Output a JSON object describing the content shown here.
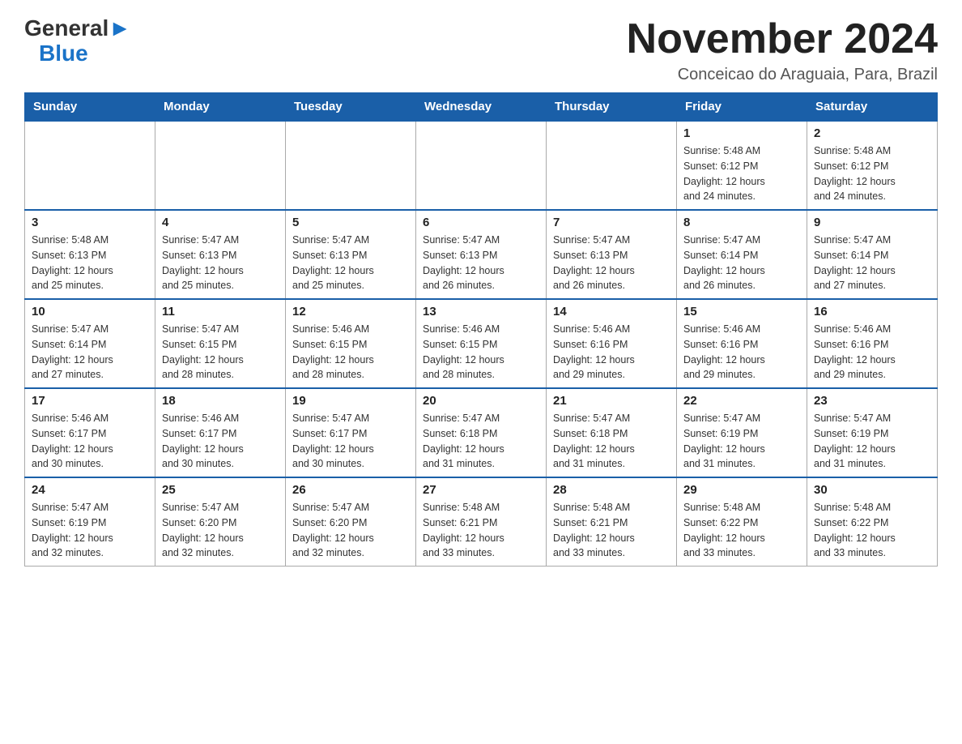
{
  "header": {
    "logo": {
      "general": "General",
      "blue": "Blue",
      "arrow": "▶"
    },
    "title": "November 2024",
    "location": "Conceicao do Araguaia, Para, Brazil"
  },
  "days_of_week": [
    "Sunday",
    "Monday",
    "Tuesday",
    "Wednesday",
    "Thursday",
    "Friday",
    "Saturday"
  ],
  "weeks": [
    [
      {
        "day": "",
        "info": ""
      },
      {
        "day": "",
        "info": ""
      },
      {
        "day": "",
        "info": ""
      },
      {
        "day": "",
        "info": ""
      },
      {
        "day": "",
        "info": ""
      },
      {
        "day": "1",
        "info": "Sunrise: 5:48 AM\nSunset: 6:12 PM\nDaylight: 12 hours\nand 24 minutes."
      },
      {
        "day": "2",
        "info": "Sunrise: 5:48 AM\nSunset: 6:12 PM\nDaylight: 12 hours\nand 24 minutes."
      }
    ],
    [
      {
        "day": "3",
        "info": "Sunrise: 5:48 AM\nSunset: 6:13 PM\nDaylight: 12 hours\nand 25 minutes."
      },
      {
        "day": "4",
        "info": "Sunrise: 5:47 AM\nSunset: 6:13 PM\nDaylight: 12 hours\nand 25 minutes."
      },
      {
        "day": "5",
        "info": "Sunrise: 5:47 AM\nSunset: 6:13 PM\nDaylight: 12 hours\nand 25 minutes."
      },
      {
        "day": "6",
        "info": "Sunrise: 5:47 AM\nSunset: 6:13 PM\nDaylight: 12 hours\nand 26 minutes."
      },
      {
        "day": "7",
        "info": "Sunrise: 5:47 AM\nSunset: 6:13 PM\nDaylight: 12 hours\nand 26 minutes."
      },
      {
        "day": "8",
        "info": "Sunrise: 5:47 AM\nSunset: 6:14 PM\nDaylight: 12 hours\nand 26 minutes."
      },
      {
        "day": "9",
        "info": "Sunrise: 5:47 AM\nSunset: 6:14 PM\nDaylight: 12 hours\nand 27 minutes."
      }
    ],
    [
      {
        "day": "10",
        "info": "Sunrise: 5:47 AM\nSunset: 6:14 PM\nDaylight: 12 hours\nand 27 minutes."
      },
      {
        "day": "11",
        "info": "Sunrise: 5:47 AM\nSunset: 6:15 PM\nDaylight: 12 hours\nand 28 minutes."
      },
      {
        "day": "12",
        "info": "Sunrise: 5:46 AM\nSunset: 6:15 PM\nDaylight: 12 hours\nand 28 minutes."
      },
      {
        "day": "13",
        "info": "Sunrise: 5:46 AM\nSunset: 6:15 PM\nDaylight: 12 hours\nand 28 minutes."
      },
      {
        "day": "14",
        "info": "Sunrise: 5:46 AM\nSunset: 6:16 PM\nDaylight: 12 hours\nand 29 minutes."
      },
      {
        "day": "15",
        "info": "Sunrise: 5:46 AM\nSunset: 6:16 PM\nDaylight: 12 hours\nand 29 minutes."
      },
      {
        "day": "16",
        "info": "Sunrise: 5:46 AM\nSunset: 6:16 PM\nDaylight: 12 hours\nand 29 minutes."
      }
    ],
    [
      {
        "day": "17",
        "info": "Sunrise: 5:46 AM\nSunset: 6:17 PM\nDaylight: 12 hours\nand 30 minutes."
      },
      {
        "day": "18",
        "info": "Sunrise: 5:46 AM\nSunset: 6:17 PM\nDaylight: 12 hours\nand 30 minutes."
      },
      {
        "day": "19",
        "info": "Sunrise: 5:47 AM\nSunset: 6:17 PM\nDaylight: 12 hours\nand 30 minutes."
      },
      {
        "day": "20",
        "info": "Sunrise: 5:47 AM\nSunset: 6:18 PM\nDaylight: 12 hours\nand 31 minutes."
      },
      {
        "day": "21",
        "info": "Sunrise: 5:47 AM\nSunset: 6:18 PM\nDaylight: 12 hours\nand 31 minutes."
      },
      {
        "day": "22",
        "info": "Sunrise: 5:47 AM\nSunset: 6:19 PM\nDaylight: 12 hours\nand 31 minutes."
      },
      {
        "day": "23",
        "info": "Sunrise: 5:47 AM\nSunset: 6:19 PM\nDaylight: 12 hours\nand 31 minutes."
      }
    ],
    [
      {
        "day": "24",
        "info": "Sunrise: 5:47 AM\nSunset: 6:19 PM\nDaylight: 12 hours\nand 32 minutes."
      },
      {
        "day": "25",
        "info": "Sunrise: 5:47 AM\nSunset: 6:20 PM\nDaylight: 12 hours\nand 32 minutes."
      },
      {
        "day": "26",
        "info": "Sunrise: 5:47 AM\nSunset: 6:20 PM\nDaylight: 12 hours\nand 32 minutes."
      },
      {
        "day": "27",
        "info": "Sunrise: 5:48 AM\nSunset: 6:21 PM\nDaylight: 12 hours\nand 33 minutes."
      },
      {
        "day": "28",
        "info": "Sunrise: 5:48 AM\nSunset: 6:21 PM\nDaylight: 12 hours\nand 33 minutes."
      },
      {
        "day": "29",
        "info": "Sunrise: 5:48 AM\nSunset: 6:22 PM\nDaylight: 12 hours\nand 33 minutes."
      },
      {
        "day": "30",
        "info": "Sunrise: 5:48 AM\nSunset: 6:22 PM\nDaylight: 12 hours\nand 33 minutes."
      }
    ]
  ]
}
